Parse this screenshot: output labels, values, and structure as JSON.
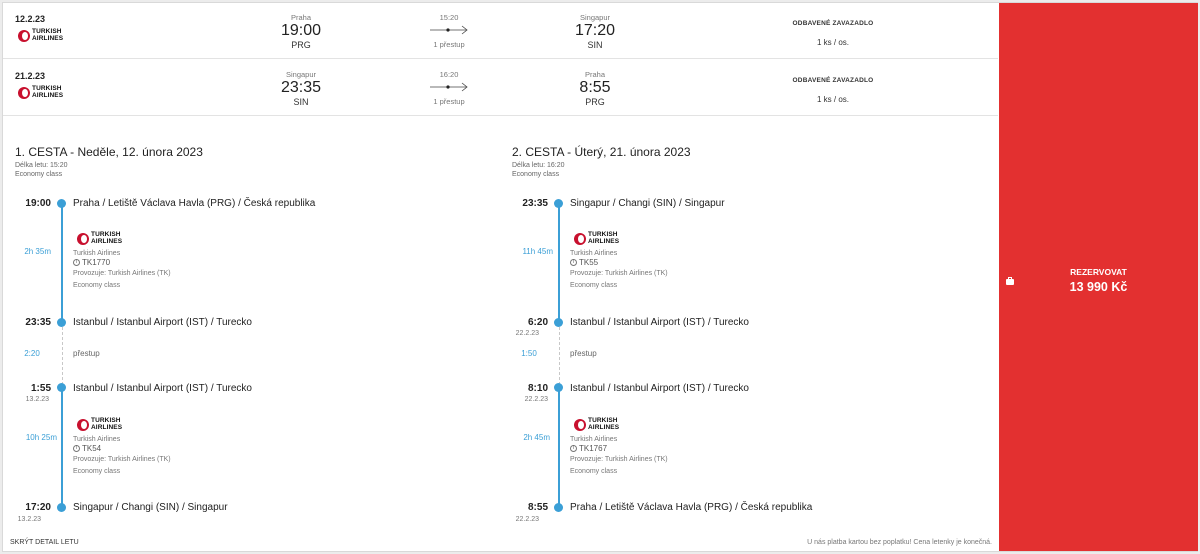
{
  "summary": [
    {
      "date": "12.2.23",
      "airline": [
        "TURKISH",
        "AIRLINES"
      ],
      "from_city": "Praha",
      "from_time": "19:00",
      "from_code": "PRG",
      "duration": "15:20",
      "stops": "1 přestup",
      "to_city": "Singapur",
      "to_time": "17:20",
      "to_code": "SIN",
      "baggage_label": "ODBAVENÉ ZAVAZADLO",
      "baggage_value": "1 ks / os."
    },
    {
      "date": "21.2.23",
      "airline": [
        "TURKISH",
        "AIRLINES"
      ],
      "from_city": "Singapur",
      "from_time": "23:35",
      "from_code": "SIN",
      "duration": "16:20",
      "stops": "1 přestup",
      "to_city": "Praha",
      "to_time": "8:55",
      "to_code": "PRG",
      "baggage_label": "ODBAVENÉ ZAVAZADLO",
      "baggage_value": "1 ks / os."
    }
  ],
  "legs": [
    {
      "title": "1. CESTA - Neděle, 12. února 2023",
      "flight_length": "Délka letu: 15:20",
      "cabin": "Economy class",
      "stops": [
        {
          "time": "19:00",
          "subdate": "",
          "place": "Praha / Letiště Václava Havla (PRG) / Česká republika"
        },
        {
          "time": "23:35",
          "subdate": "",
          "place": "Istanbul / Istanbul Airport (IST) / Turecko"
        },
        {
          "time": "1:55",
          "subdate": "13.2.23",
          "place": "Istanbul / Istanbul Airport (IST) / Turecko"
        },
        {
          "time": "17:20",
          "subdate": "13.2.23",
          "place": "Singapur / Changi (SIN) / Singapur"
        }
      ],
      "segments": [
        {
          "duration": "2h 35m",
          "airline_name": "Turkish Airlines",
          "flight": "TK1770",
          "operated": "Provozuje: Turkish Airlines (TK)",
          "cabin": "Economy class"
        },
        {
          "duration": "10h 25m",
          "airline_name": "Turkish Airlines",
          "flight": "TK54",
          "operated": "Provozuje: Turkish Airlines (TK)",
          "cabin": "Economy class"
        }
      ],
      "layover": {
        "duration": "2:20",
        "label": "přestup"
      }
    },
    {
      "title": "2. CESTA - Úterý, 21. února 2023",
      "flight_length": "Délka letu: 16:20",
      "cabin": "Economy class",
      "stops": [
        {
          "time": "23:35",
          "subdate": "",
          "place": "Singapur / Changi (SIN) / Singapur"
        },
        {
          "time": "6:20",
          "subdate": "22.2.23",
          "place": "Istanbul / Istanbul Airport (IST) / Turecko"
        },
        {
          "time": "8:10",
          "subdate": "22.2.23",
          "place": "Istanbul / Istanbul Airport (IST) / Turecko"
        },
        {
          "time": "8:55",
          "subdate": "22.2.23",
          "place": "Praha / Letiště Václava Havla (PRG) / Česká republika"
        }
      ],
      "segments": [
        {
          "duration": "11h 45m",
          "airline_name": "Turkish Airlines",
          "flight": "TK55",
          "operated": "Provozuje: Turkish Airlines (TK)",
          "cabin": "Economy class"
        },
        {
          "duration": "2h 45m",
          "airline_name": "Turkish Airlines",
          "flight": "TK1767",
          "operated": "Provozuje: Turkish Airlines (TK)",
          "cabin": "Economy class"
        }
      ],
      "layover": {
        "duration": "1:50",
        "label": "přestup"
      }
    }
  ],
  "footer": {
    "hide_detail": "SKRÝT DETAIL LETU",
    "note": "U nás platba kartou bez poplatku! Cena letenky je konečná."
  },
  "book": {
    "label": "REZERVOVAT",
    "price": "13 990 Kč",
    "icon": "briefcase-icon"
  },
  "colors": {
    "accent_blue": "#3b9fd6",
    "book_red": "#e33030",
    "airline_red": "#c8102e"
  }
}
